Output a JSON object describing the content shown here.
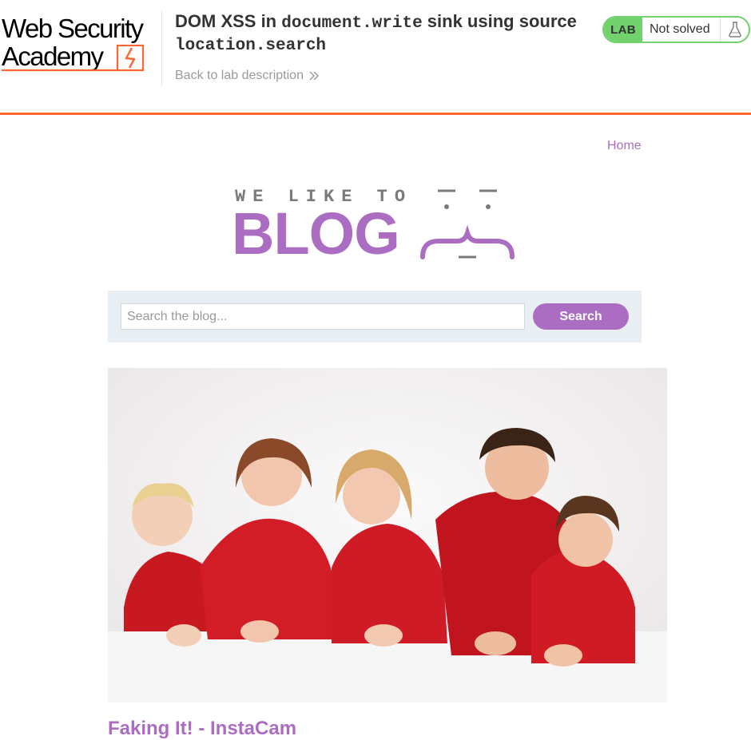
{
  "academy": {
    "logo_line1": "Web Security",
    "logo_line2": "Academy",
    "lab_title_prefix": "DOM XSS in ",
    "lab_title_code1": "document.write",
    "lab_title_middle": " sink using source ",
    "lab_title_code2": "location.search",
    "back_link": "Back to lab description",
    "status_badge": "LAB",
    "status_text": "Not solved",
    "accent_color": "#ff6633",
    "status_color": "#70d16d"
  },
  "nav": {
    "home": "Home"
  },
  "banner": {
    "tagline": "WE LIKE TO",
    "word": "BLOG"
  },
  "search": {
    "placeholder": "Search the blog...",
    "button": "Search"
  },
  "post": {
    "title": "Faking It! - InstaCam"
  },
  "colors": {
    "brand": "#aa6dc2",
    "search_panel": "#e8eef1"
  }
}
